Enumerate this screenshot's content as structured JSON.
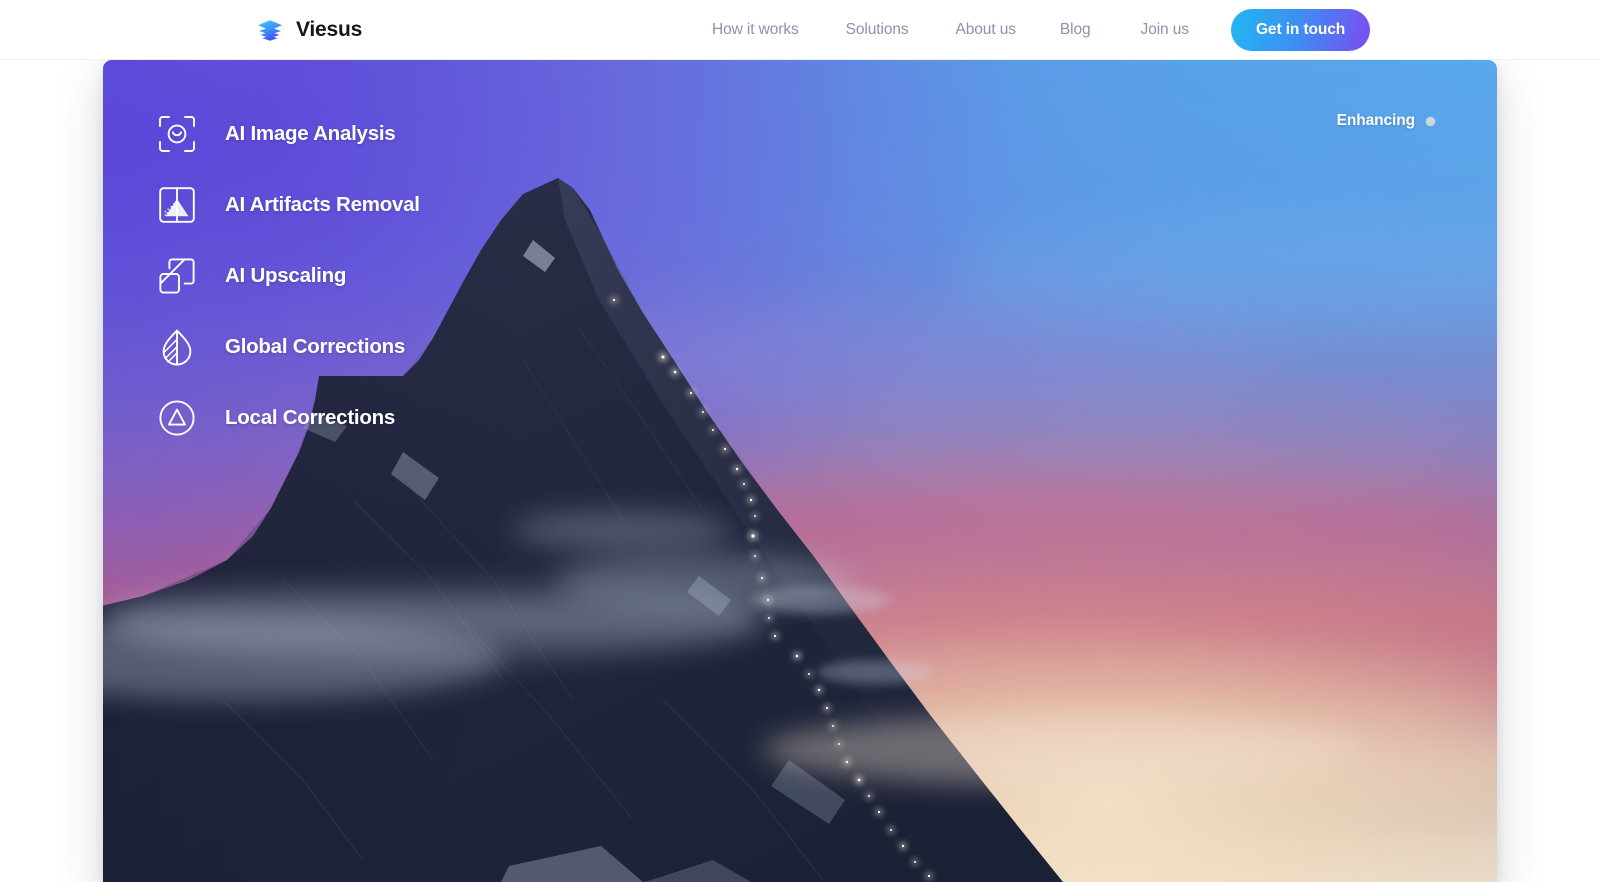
{
  "header": {
    "brand": {
      "name": "Viesus",
      "logo_icon": "stacked-layers-icon"
    },
    "nav": [
      {
        "label": "How it works"
      },
      {
        "label": "Solutions"
      },
      {
        "label": "About us"
      },
      {
        "label": "Blog"
      },
      {
        "label": "Join us"
      }
    ],
    "cta": {
      "label": "Get in touch"
    }
  },
  "hero": {
    "photo_alt": "Matterhorn mountain peak at dusk with a line of climbers' head-lamp lights along the ridge",
    "features": [
      {
        "label": "AI Image Analysis",
        "icon": "face-detect-frame-icon"
      },
      {
        "label": "AI Artifacts Removal",
        "icon": "noise-removal-icon"
      },
      {
        "label": "AI Upscaling",
        "icon": "overlapping-squares-icon"
      },
      {
        "label": "Global Corrections",
        "icon": "leaf-contrast-icon"
      },
      {
        "label": "Local Corrections",
        "icon": "circle-triangle-icon"
      }
    ],
    "status": {
      "label": "Enhancing",
      "indicator": "status-dot"
    }
  },
  "colors": {
    "brand_cyan": "#21b7f2",
    "brand_purple": "#7b4cf0",
    "nav_text": "#8b93a8",
    "brand_text": "#14161c",
    "card_top_left": "#5b4fd8",
    "card_top_right": "#5ba3e8",
    "page_background": "#ffffff",
    "status_dot": "#cfd6de"
  }
}
